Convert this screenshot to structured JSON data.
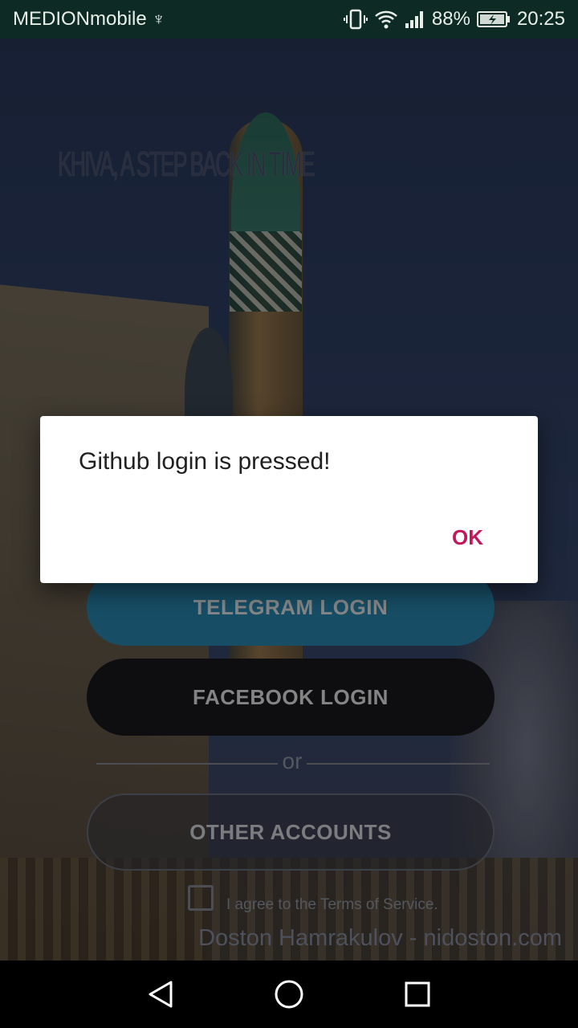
{
  "status_bar": {
    "carrier": "MEDIONmobile",
    "battery_percent": "88%",
    "time": "20:25",
    "icons": [
      "usb-icon",
      "vibrate-icon",
      "wifi-icon",
      "signal-icon",
      "battery-charging-icon"
    ]
  },
  "background": {
    "sign_text": "KHIVA, A STEP BACK IN TIME"
  },
  "login": {
    "telegram_label": "TELEGRAM LOGIN",
    "facebook_label": "FACEBOOK LOGIN",
    "or_label": "or",
    "other_label": "OTHER ACCOUNTS",
    "terms_label": "I agree to the Terms of Service.",
    "terms_checked": false,
    "footer": "Doston Hamrakulov - nidoston.com"
  },
  "dialog": {
    "message": "Github login is pressed!",
    "ok_label": "OK"
  },
  "nav_bar": {
    "icons": [
      "back-icon",
      "home-icon",
      "recents-icon"
    ]
  },
  "colors": {
    "accent": "#c2185b",
    "telegram": "#2a8fb8",
    "facebook": "#1a1a1e",
    "status_bar": "#0d2a24"
  }
}
